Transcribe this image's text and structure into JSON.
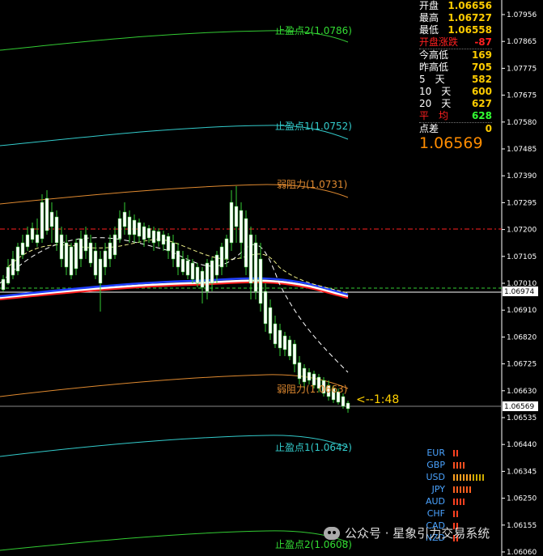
{
  "info_panel": [
    {
      "label": "开盘",
      "value": "1.06656",
      "label_color": "#ffffff",
      "value_color": "#ffcc00"
    },
    {
      "label": "最高",
      "value": "1.06727",
      "label_color": "#ffffff",
      "value_color": "#ffcc00"
    },
    {
      "label": "最低",
      "value": "1.06558",
      "label_color": "#ffffff",
      "value_color": "#ffcc00"
    },
    {
      "label": "开盘涨跌",
      "value": "-87",
      "label_color": "#ff2020",
      "value_color": "#ff2020"
    },
    {
      "label": "今高低",
      "value": "169",
      "label_color": "#ffffff",
      "value_color": "#ffcc00"
    },
    {
      "label": "昨高低",
      "value": "705",
      "label_color": "#ffffff",
      "value_color": "#ffcc00"
    },
    {
      "label": "5　天",
      "value": "582",
      "label_color": "#ffffff",
      "value_color": "#ffcc00"
    },
    {
      "label": "10　天",
      "value": "600",
      "label_color": "#ffffff",
      "value_color": "#ffcc00"
    },
    {
      "label": "20　天",
      "value": "627",
      "label_color": "#ffffff",
      "value_color": "#ffcc00"
    },
    {
      "label": "平　均",
      "value": "628",
      "label_color": "#ff2020",
      "value_color": "#33ff33"
    },
    {
      "label": "点差",
      "value": "0",
      "label_color": "#ffffff",
      "value_color": "#ffcc00"
    }
  ],
  "current_price": "1.06569",
  "countdown": "<--1:48",
  "price_axis": {
    "ticks": [
      "1.07956",
      "1.07865",
      "1.07775",
      "1.07675",
      "1.07580",
      "1.07485",
      "1.07390",
      "1.07295",
      "1.07200",
      "1.07105",
      "1.07010",
      "1.06910",
      "1.06820",
      "1.06725",
      "1.06630",
      "1.06535",
      "1.06440",
      "1.06345",
      "1.06250",
      "1.06155",
      "1.06060"
    ],
    "price_tag_1": "1.06974",
    "price_tag_2": "1.06569"
  },
  "zones": [
    {
      "text": "止盈点2(1.0786)",
      "color": "#33dd33"
    },
    {
      "text": "止盈点1(1.0752)",
      "color": "#33cccc"
    },
    {
      "text": "弱阻力(1.0731)",
      "color": "#e08a30"
    },
    {
      "text": "弱阻力(1.0663)",
      "color": "#e08a30"
    },
    {
      "text": "止盈点1(1.0642)",
      "color": "#33cccc"
    },
    {
      "text": "止盈点2(1.0608)",
      "color": "#33dd33"
    }
  ],
  "currency_strength": [
    {
      "name": "EUR",
      "level": 2,
      "color": "#ff4020"
    },
    {
      "name": "GBP",
      "level": 4,
      "color": "#ff5020"
    },
    {
      "name": "USD",
      "level": 10,
      "color": "#ffa020"
    },
    {
      "name": "JPY",
      "level": 6,
      "color": "#ff6020"
    },
    {
      "name": "AUD",
      "level": 4,
      "color": "#ff4020"
    },
    {
      "name": "CHF",
      "level": 2,
      "color": "#ff4020"
    },
    {
      "name": "CAD",
      "level": 2,
      "color": "#ff4020"
    },
    {
      "name": "NZD",
      "level": 2,
      "color": "#ff4020"
    }
  ],
  "watermark": "公众号 · 星象引力交易系统",
  "colors": {
    "background": "#000000",
    "candle": "#ffffff",
    "red_line": "#ff2020",
    "green_dashed": "#33cc33"
  }
}
